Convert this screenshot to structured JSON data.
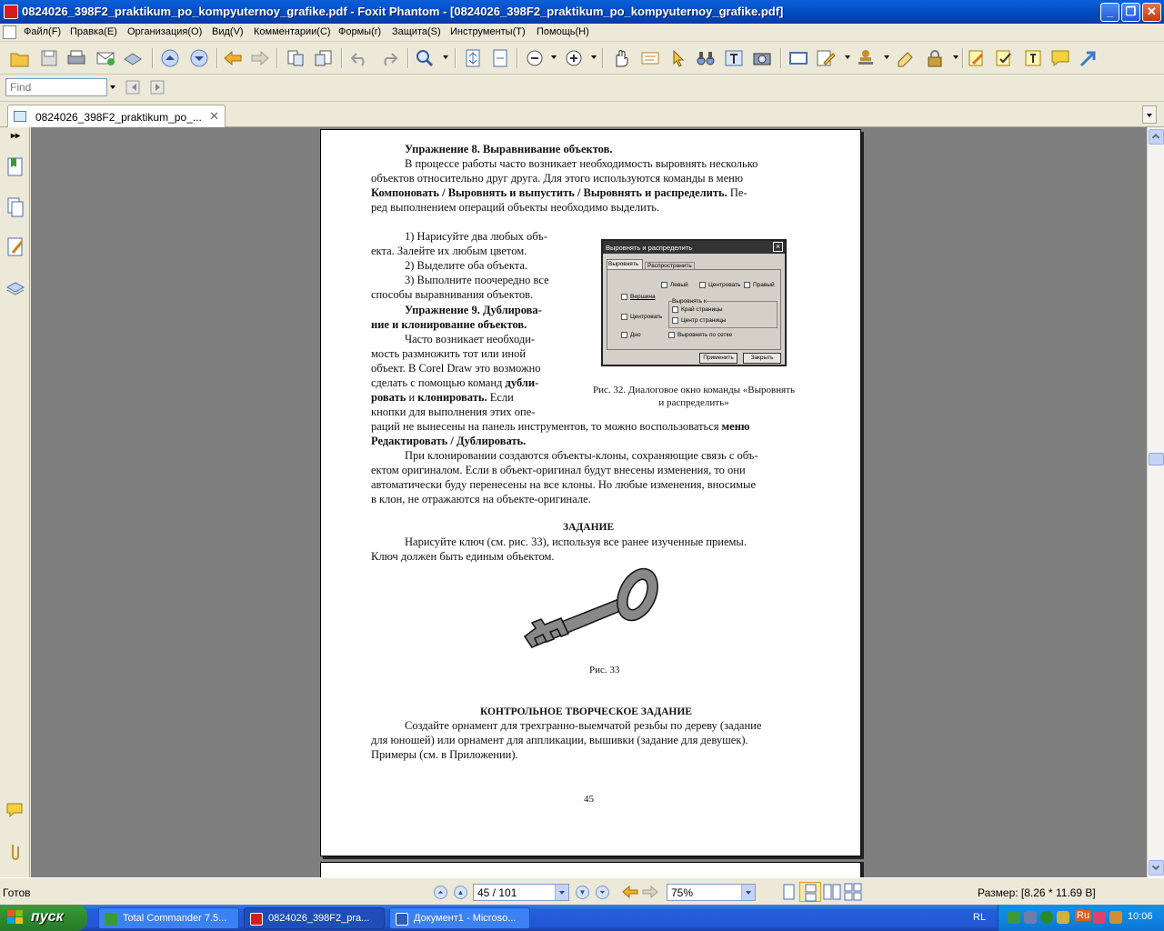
{
  "window": {
    "title": "0824026_398F2_praktikum_po_kompyuternoy_grafike.pdf - Foxit Phantom - [0824026_398F2_praktikum_po_kompyuternoy_grafike.pdf]",
    "minimize": "_",
    "restore": "❐",
    "close": "✕"
  },
  "menu": {
    "items": [
      "Файл(F)",
      "Правка(E)",
      "Организация(O)",
      "Вид(V)",
      "Комментарии(C)",
      "Формы(r)",
      "Защита(S)",
      "Инструменты(T)",
      "Помощь(H)"
    ]
  },
  "find": {
    "placeholder": "Find"
  },
  "tab": {
    "label": "0824026_398F2_praktikum_po_...",
    "close": "✕"
  },
  "document": {
    "ex8_title": "Упражнение 8. Выравнивание объектов.",
    "p1_l1": "В процессе работы часто возникает необходимость выровнять несколько",
    "p1_l2": "объектов относительно друг друга. Для этого используются команды в меню",
    "p1_l3a": "Компоновать / Выровнять и выпустить / Выровнять и распределить.",
    "p1_l3b": " Пе-",
    "p1_l4": "ред выполнением операций объекты необходимо выделить.",
    "s1_l1": "1) Нарисуйте два любых объ-",
    "s1_l2": "екта. Залейте их любым цветом.",
    "s2": "2) Выделите оба объекта.",
    "s3_l1": "3) Выполните поочередно все",
    "s3_l2": "способы выравнивания объектов.",
    "ex9_l1": "Упражнение 9. Дублирова-",
    "ex9_l2": "ние и клонирование объектов.",
    "p2_l1": "Часто возникает необходи-",
    "p2_l2": "мость размножить тот или иной",
    "p2_l3": "объект. В Corel Draw это возможно",
    "p2_l4a": "сделать с помощью команд ",
    "p2_l4b": "дубли-",
    "p2_l5a": "ровать",
    "p2_l5b": " и ",
    "p2_l5c": "клонировать.",
    "p2_l5d": " Если",
    "p2_l6": "кнопки для выполнения этих опе-",
    "p2_l7a": "раций не вынесены на панель инструментов, то можно воспользоваться ",
    "p2_l7b": "меню",
    "p2_l8": "Редактировать / Дублировать.",
    "p3_l1": "При клонировании создаются объекты-клоны, сохраняющие связь с объ-",
    "p3_l2": "ектом оригиналом. Если в объект-оригинал будут внесены изменения, то они",
    "p3_l3": "автоматически буду перенесены на все клоны. Но любые изменения, вносимые",
    "p3_l4": "в клон, не отражаются на объекте-оригинале.",
    "task_title": "ЗАДАНИЕ",
    "task_l1": "Нарисуйте ключ (см. рис. 33), используя все ранее изученные приемы.",
    "task_l2": "Ключ должен быть единым объектом.",
    "fig33": "Рис. 33",
    "creative_title": "КОНТРОЛЬНОЕ ТВОРЧЕСКОЕ ЗАДАНИЕ",
    "cr_l1": "Создайте орнамент для трехгранно-выемчатой резьбы по дереву (задание",
    "cr_l2": "для юношей) или орнамент для аппликации, вышивки (задание для девушек).",
    "cr_l3": "Примеры (см. в Приложении).",
    "page_number": "45",
    "fig32_l1": "Рис. 32. Диалоговое окно команды «Выровнять",
    "fig32_l2": "и распределить»"
  },
  "dialog": {
    "title": "Выровнять и распределить",
    "tab1": "Выровнять",
    "tab2": "Распространить",
    "left": "Левый",
    "center": "Центровать",
    "right": "Правый",
    "top": "Вершина",
    "vcenter": "Центровать",
    "bottom": "Дно",
    "align_to": "Выровнять к",
    "page_edge": "Край страницы",
    "page_center": "Центр страницы",
    "grid": "Выровнять по сетке",
    "apply": "Применить",
    "close": "Закрыть"
  },
  "status": {
    "ready": "Готов",
    "page": "45 / 101",
    "zoom": "75%",
    "size": "Размер: [8.26 * 11.69 В]"
  },
  "taskbar": {
    "start": "пуск",
    "tasks": [
      "Total Commander 7.5...",
      "0824026_398F2_pra...",
      "Документ1 - Microso..."
    ],
    "lang": "RL",
    "tray_lang": "Ru",
    "clock": "10:06"
  }
}
